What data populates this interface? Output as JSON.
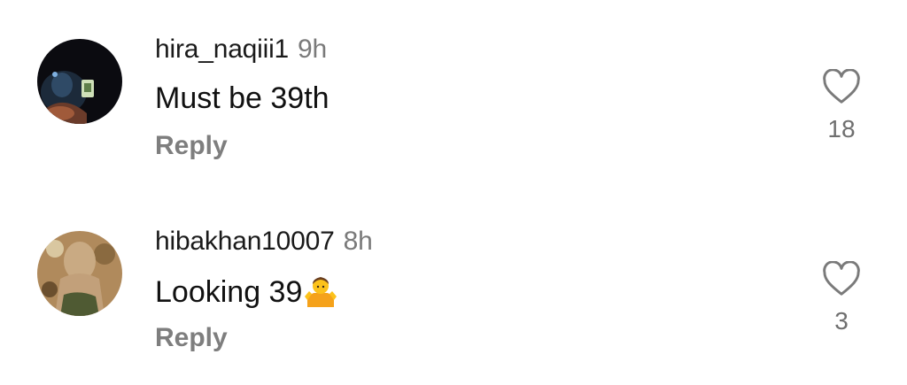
{
  "comments": [
    {
      "username": "hira_naqiii1",
      "time": "9h",
      "text": "Must be 39th",
      "reply_label": "Reply",
      "likes": "18",
      "avatar_icon": "dark-profile-photo"
    },
    {
      "username": "hibakhan10007",
      "time": "8h",
      "text": "Looking 39",
      "emoji_icon": "person-shrugging-emoji",
      "reply_label": "Reply",
      "likes": "3",
      "avatar_icon": "hijab-profile-photo"
    }
  ],
  "icons": {
    "like": "heart-outline-icon"
  },
  "colors": {
    "secondary_text": "#7e7e7e",
    "primary_text": "#111111",
    "background": "#ffffff"
  }
}
